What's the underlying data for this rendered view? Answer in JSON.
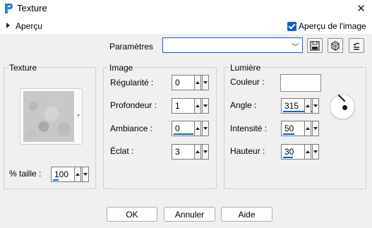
{
  "window": {
    "title": "Texture",
    "close_glyph": "✕",
    "app_icon": "paint-app-icon"
  },
  "preview": {
    "toggle_label": "Aperçu",
    "image_preview_label": "Aperçu de l'image",
    "image_preview_checked": true
  },
  "params": {
    "label": "Paramètres",
    "value": "",
    "tools": [
      "save-preset-icon",
      "randomize-icon",
      "reset-icon"
    ]
  },
  "texture_group": {
    "title": "Texture",
    "scale_label": "% taille :",
    "scale_value": "100"
  },
  "image_group": {
    "title": "Image",
    "fields": [
      {
        "label": "Régularité :",
        "value": "0"
      },
      {
        "label": "Profondeur :",
        "value": "1"
      },
      {
        "label": "Ambiance :",
        "value": "0"
      },
      {
        "label": "Éclat :",
        "value": "3"
      }
    ]
  },
  "light_group": {
    "title": "Lumière",
    "color_label": "Couleur :",
    "color_value": "#ffffff",
    "fields": [
      {
        "label": "Angle :",
        "value": "315"
      },
      {
        "label": "Intensité :",
        "value": "50"
      },
      {
        "label": "Hauteur :",
        "value": "30"
      }
    ]
  },
  "buttons": {
    "ok": "OK",
    "cancel": "Annuler",
    "help": "Aide"
  },
  "colors": {
    "accent": "#0a64c8",
    "background": "#f0f0f0"
  }
}
